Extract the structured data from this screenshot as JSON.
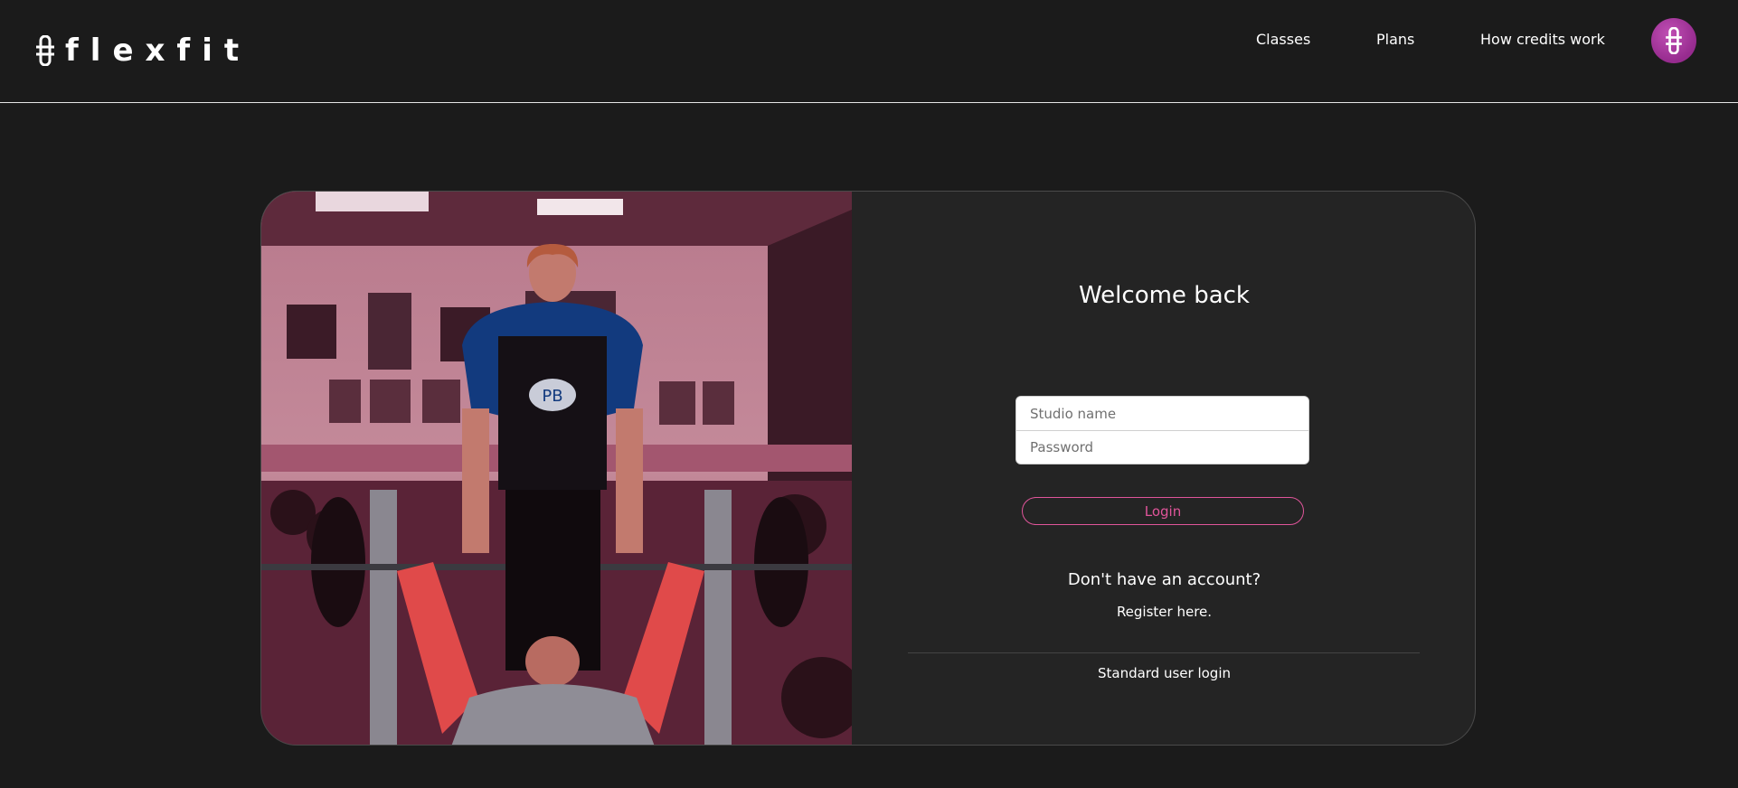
{
  "header": {
    "logo_text": "flexfit",
    "nav": [
      {
        "label": "Classes"
      },
      {
        "label": "Plans"
      },
      {
        "label": "How credits work"
      }
    ]
  },
  "login": {
    "title": "Welcome back",
    "studio_placeholder": "Studio name",
    "password_placeholder": "Password",
    "login_label": "Login",
    "no_account_text": "Don't have an account?",
    "register_label": "Register here.",
    "standard_login_label": "Standard user login"
  },
  "colors": {
    "background": "#1b1b1b",
    "card": "#242424",
    "accent_pink": "#e0559a",
    "avatar_purple": "#a3369a"
  },
  "icons": {
    "logo": "barbell-mark-icon",
    "avatar": "barbell-mark-icon"
  }
}
